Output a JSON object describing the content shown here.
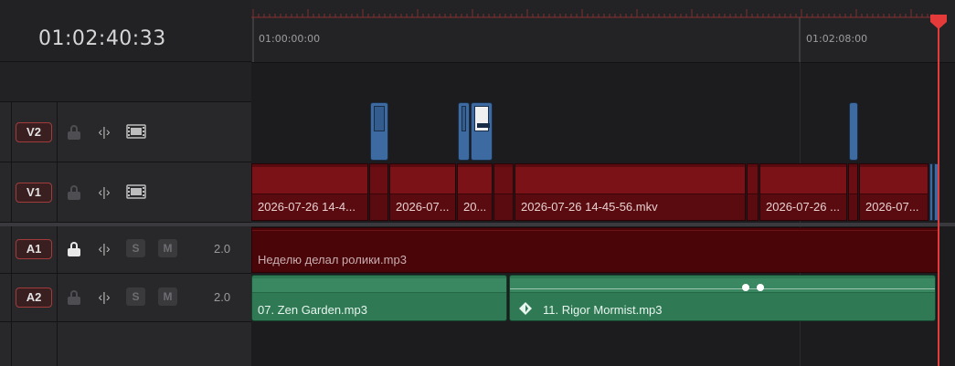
{
  "timecode": "01:02:40:33",
  "ruler": {
    "labels": [
      "01:00:00:00",
      "01:02:08:00"
    ]
  },
  "tracks": {
    "v2": {
      "label": "V2"
    },
    "v1": {
      "label": "V1",
      "clips": [
        "2026-07-26 14-4...",
        "2026-07...",
        "20...",
        "2026-07-26 14-45-56.mkv",
        "2026-07-26 ...",
        "2026-07..."
      ]
    },
    "a1": {
      "label": "A1",
      "level": "2.0",
      "solo": "S",
      "mute": "M",
      "clip": "Неделю делал ролики.mp3"
    },
    "a2": {
      "label": "A2",
      "level": "2.0",
      "solo": "S",
      "mute": "M",
      "clips": [
        "07. Zen Garden.mp3",
        "11. Rigor Mormist.mp3"
      ]
    }
  },
  "colors": {
    "accent": "#e53a3a",
    "video_clip": "#5a0b10",
    "audio_a1": "#4a0509",
    "audio_a2": "#2f7a55",
    "v2_clip": "#3d6aa0"
  },
  "icons": [
    "lock-icon",
    "trim-icon",
    "film-strip-icon",
    "playhead-icon",
    "keyframe-diamond-icon"
  ]
}
